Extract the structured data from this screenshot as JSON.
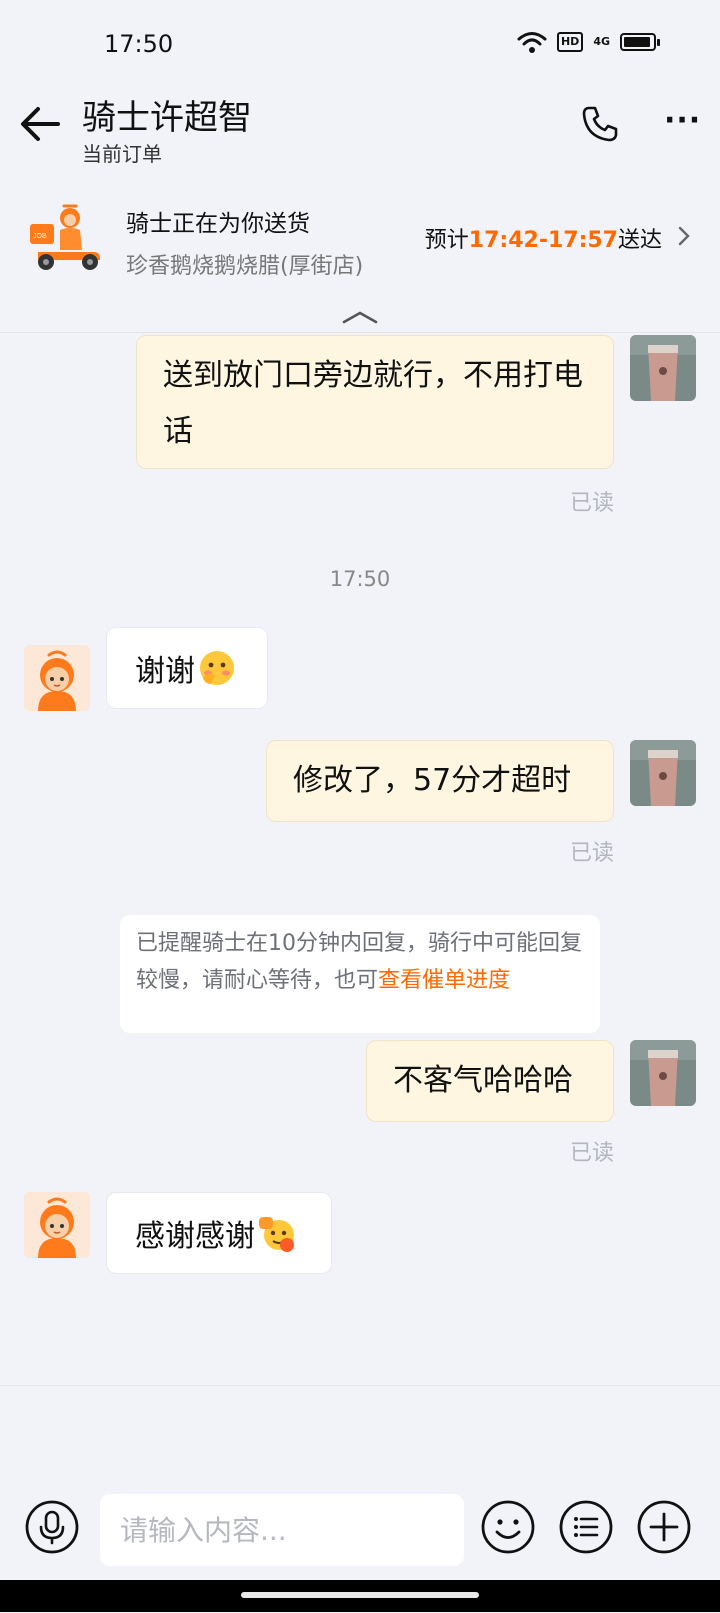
{
  "status_bar": {
    "time": "17:50",
    "hd": "HD",
    "network": "4G",
    "battery_level": 0.82
  },
  "header": {
    "title": "骑士许超智",
    "subtitle": "当前订单"
  },
  "delivery": {
    "status": "骑士正在为你送货",
    "shop": "珍香鹅烧鹅烧腊(厚街店)",
    "eta_prefix": "预计",
    "eta_time": "17:42-17:57",
    "eta_suffix": "送达"
  },
  "messages": [
    {
      "side": "out",
      "text": "送到放门口旁边就行，不用打电话",
      "status": "已读"
    },
    {
      "type": "timestamp",
      "text": "17:50"
    },
    {
      "side": "in",
      "text": "谢谢",
      "emoji": "blushing-emoji"
    },
    {
      "side": "out",
      "text": "修改了，57分才超时",
      "status": "已读"
    },
    {
      "type": "system",
      "text": "已提醒骑士在10分钟内回复，骑行中可能回复较慢，请耐心等待，也可",
      "link": "查看催单进度"
    },
    {
      "side": "out",
      "text": "不客气哈哈哈",
      "status": "已读"
    },
    {
      "side": "in",
      "text": "感谢感谢",
      "emoji": "fist-bump-emoji"
    }
  ],
  "input": {
    "placeholder": "请输入内容..."
  },
  "colors": {
    "accent": "#ff6a00",
    "outgoing_bubble": "#fff6e1",
    "background": "#f1f3f8"
  }
}
